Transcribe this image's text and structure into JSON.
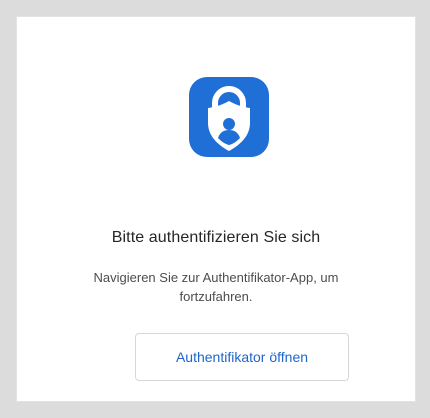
{
  "icons": {
    "app_icon": "authenticator-shield-lock-icon"
  },
  "colors": {
    "background": "#dcdcdc",
    "card": "#ffffff",
    "brand_blue": "#1f6fd6",
    "button_text": "#1f66c9",
    "title_text": "#262626",
    "body_text": "#4d4d4d"
  },
  "dialog": {
    "title": "Bitte authentifizieren Sie sich",
    "description": "Navigieren Sie zur Authentifikator-App, um fortzufahren.",
    "button_label": "Authentifikator öffnen"
  }
}
